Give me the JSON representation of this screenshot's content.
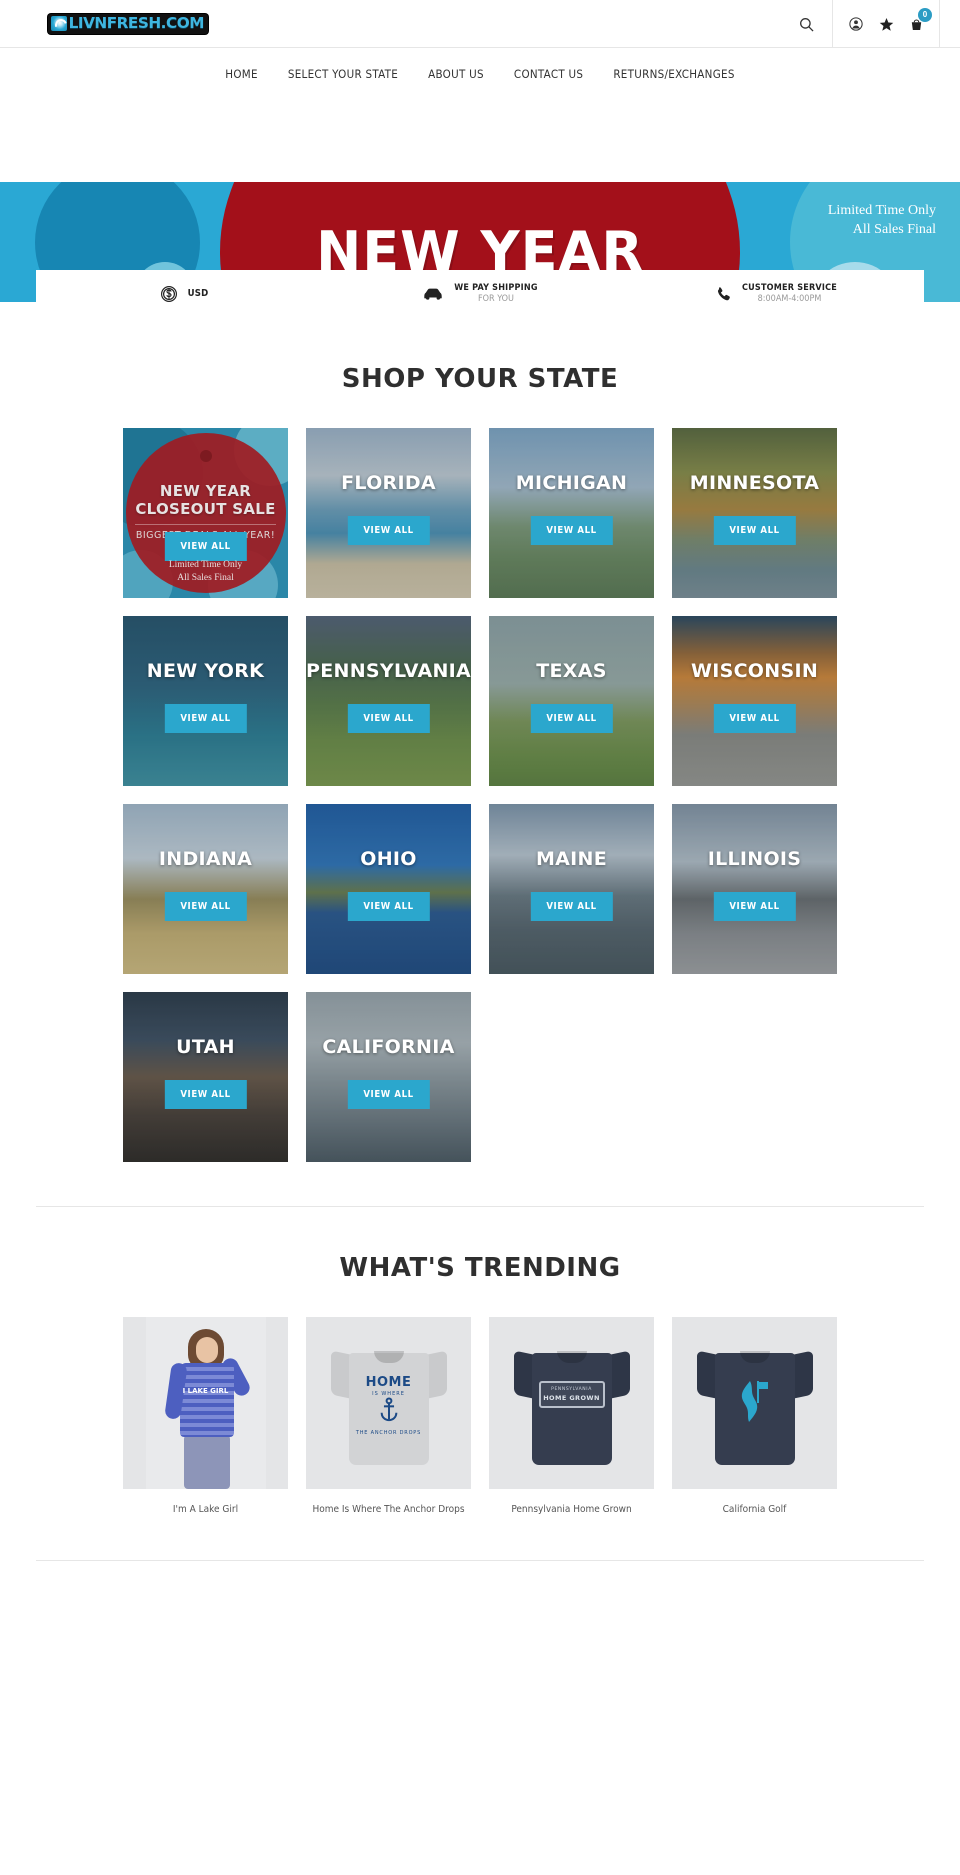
{
  "header": {
    "logo_text": "LIVNFRESH.COM",
    "icons": {
      "search": "search-icon",
      "account": "account-icon",
      "wishlist": "star-icon",
      "cart": "cart-icon"
    },
    "cart_count": "0"
  },
  "nav": {
    "items": [
      {
        "label": "HOME"
      },
      {
        "label": "SELECT YOUR STATE"
      },
      {
        "label": "ABOUT US"
      },
      {
        "label": "CONTACT US"
      },
      {
        "label": "RETURNS/EXCHANGES"
      }
    ]
  },
  "hero": {
    "title": "NEW YEAR",
    "note_line1": "Limited Time Only",
    "note_line2": "All Sales Final"
  },
  "service_bar": {
    "items": [
      {
        "icon": "dollar-icon",
        "line1": "USD",
        "line2": ""
      },
      {
        "icon": "car-icon",
        "line1": "WE PAY SHIPPING",
        "line2": "FOR YOU"
      },
      {
        "icon": "phone-icon",
        "line1": "CUSTOMER SERVICE",
        "line2": "8:00AM-4:00PM"
      }
    ]
  },
  "shop_your_state": {
    "title": "SHOP YOUR STATE",
    "view_all_label": "VIEW ALL",
    "promo": {
      "line1": "NEW YEAR",
      "line2": "CLOSEOUT SALE",
      "subtitle": "BIGGEST DEALS ALL YEAR!",
      "fine1": "Limited Time Only",
      "fine2": "All Sales Final",
      "button": "VIEW ALL"
    },
    "states": [
      {
        "name": "FLORIDA"
      },
      {
        "name": "MICHIGAN"
      },
      {
        "name": "MINNESOTA"
      },
      {
        "name": "NEW YORK"
      },
      {
        "name": "PENNSYLVANIA"
      },
      {
        "name": "TEXAS"
      },
      {
        "name": "WISCONSIN"
      },
      {
        "name": "INDIANA"
      },
      {
        "name": "OHIO"
      },
      {
        "name": "MAINE"
      },
      {
        "name": "ILLINOIS"
      },
      {
        "name": "UTAH"
      },
      {
        "name": "CALIFORNIA"
      }
    ]
  },
  "whats_trending": {
    "title": "WHAT'S TRENDING",
    "products": [
      {
        "name": "I'm A Lake Girl",
        "art": "I LAKE GIRL"
      },
      {
        "name": "Home Is Where The Anchor Drops",
        "art_top": "HOME",
        "art_mid": "IS WHERE",
        "art_bottom": "THE ANCHOR DROPS"
      },
      {
        "name": "Pennsylvania Home Grown",
        "art_top": "PENNSYLVANIA",
        "art_bottom": "HOME GROWN"
      },
      {
        "name": "California Golf",
        "art": ""
      }
    ]
  },
  "colors": {
    "accent": "#2ba7cd",
    "hero_red": "#a3101a",
    "hero_blue": "#2aa8d4",
    "text": "#2f2f2f"
  }
}
